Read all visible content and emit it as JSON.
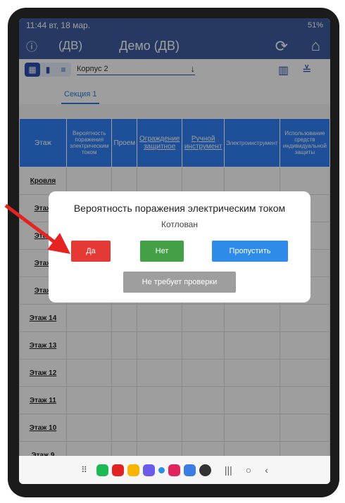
{
  "status": {
    "time": "11:44",
    "date": "вт, 18 мар.",
    "right": "51%"
  },
  "appbar": {
    "code": "(ДВ)",
    "title": "Демо (ДВ)"
  },
  "toolbar": {
    "building": "Корпус 2"
  },
  "tabs": [
    "Секция 1"
  ],
  "table": {
    "headers": [
      "Этаж",
      "Вероятность поражения электрическим током",
      "Проем",
      "Ограждение защитное",
      "Ручной инструмент",
      "Электроинструмент",
      "Использование средств индивидуальной защиты"
    ],
    "floors": [
      "Кровля",
      "Этаж",
      "Этаж",
      "Этаж",
      "Этаж",
      "Этаж 14",
      "Этаж 13",
      "Этаж 12",
      "Этаж 11",
      "Этаж 10",
      "Этаж 9"
    ]
  },
  "dialog": {
    "title": "Вероятность поражения электрическим током",
    "subtitle": "Котлован",
    "yes": "Да",
    "no": "Нет",
    "skip": "Пропустить",
    "no_check": "Не требует проверки"
  },
  "colors": {
    "appbar": "#3f5da0",
    "header": "#2f82f5",
    "yes": "#e53935",
    "no": "#43a047",
    "skip": "#2f8be8",
    "none": "#9e9e9e"
  }
}
